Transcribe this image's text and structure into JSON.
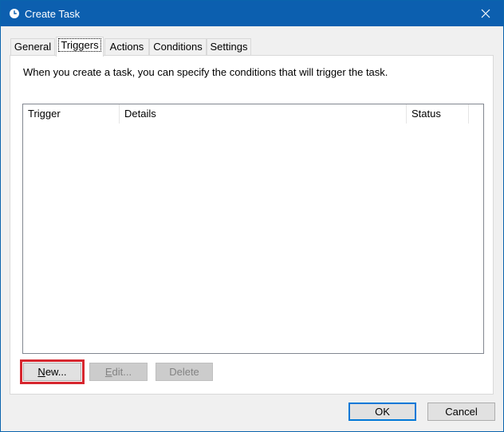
{
  "window": {
    "title": "Create Task",
    "icon": "clock-icon",
    "accent_color": "#0c5faf"
  },
  "tabs": [
    {
      "label": "General"
    },
    {
      "label": "Triggers",
      "active": true
    },
    {
      "label": "Actions"
    },
    {
      "label": "Conditions"
    },
    {
      "label": "Settings"
    }
  ],
  "triggers_panel": {
    "description": "When you create a task, you can specify the conditions that will trigger the task.",
    "columns": [
      "Trigger",
      "Details",
      "Status"
    ],
    "rows": [],
    "buttons": {
      "new": {
        "mnemonic": "N",
        "rest": "ew...",
        "enabled": true,
        "highlight_color": "#d6262e"
      },
      "edit": {
        "mnemonic": "E",
        "rest": "dit...",
        "enabled": false
      },
      "delete": {
        "label": "Delete",
        "enabled": false
      }
    }
  },
  "footer": {
    "ok_label": "OK",
    "cancel_label": "Cancel"
  }
}
